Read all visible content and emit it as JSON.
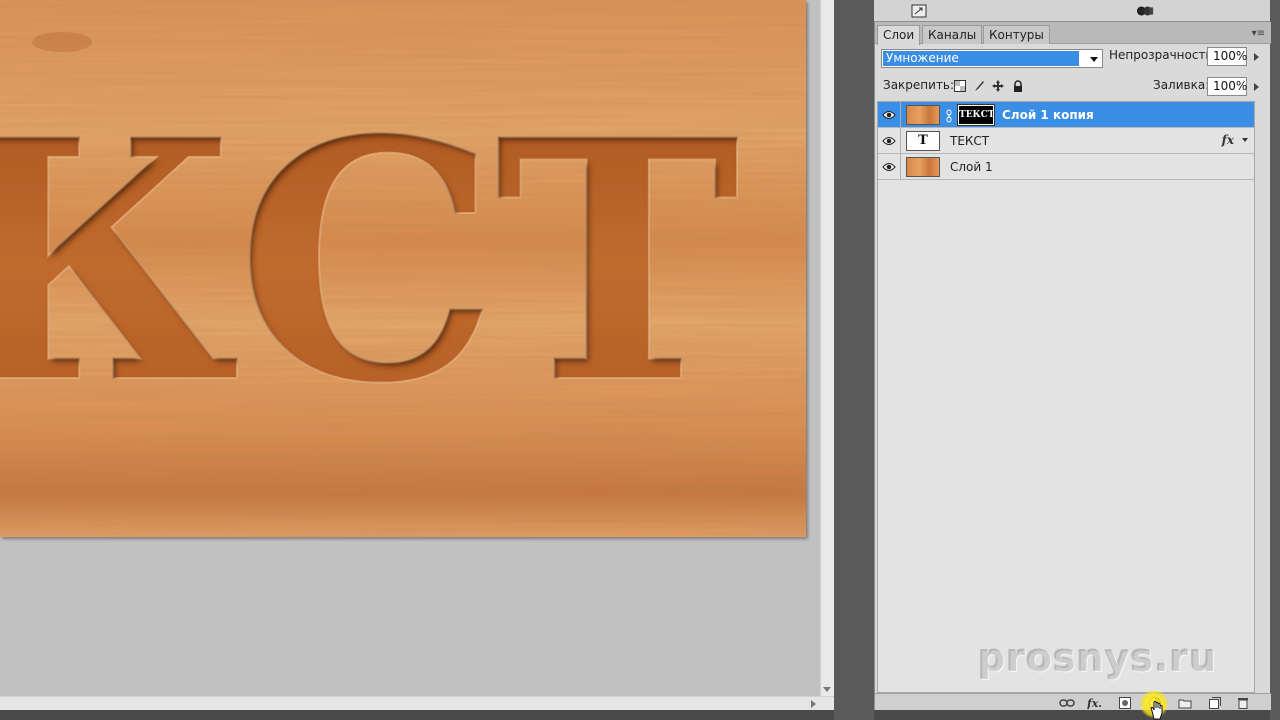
{
  "panel": {
    "tabs": [
      {
        "label": "Слои",
        "active": true
      },
      {
        "label": "Каналы",
        "active": false
      },
      {
        "label": "Контуры",
        "active": false
      }
    ],
    "blend_mode": "Умножение",
    "opacity_label": "Непрозрачность:",
    "opacity_value": "100%",
    "lock_label": "Закрепить:",
    "fill_label": "Заливка:",
    "fill_value": "100%",
    "layers": [
      {
        "name": "Слой 1 копия",
        "selected": true,
        "thumb": "wood",
        "mask_text": "ТЕКСТ"
      },
      {
        "name": "ТЕКСТ",
        "selected": false,
        "thumb": "text",
        "thumb_glyph": "T",
        "fx": "fx"
      },
      {
        "name": "Слой 1",
        "selected": false,
        "thumb": "wood"
      }
    ]
  },
  "canvas": {
    "text": "КСТ"
  },
  "watermark": "prosnys.ru",
  "colors": {
    "selection": "#3a8ee6",
    "wood_light": "#e3a064",
    "wood_dark": "#b7612a",
    "panel_bg": "#dadada"
  }
}
